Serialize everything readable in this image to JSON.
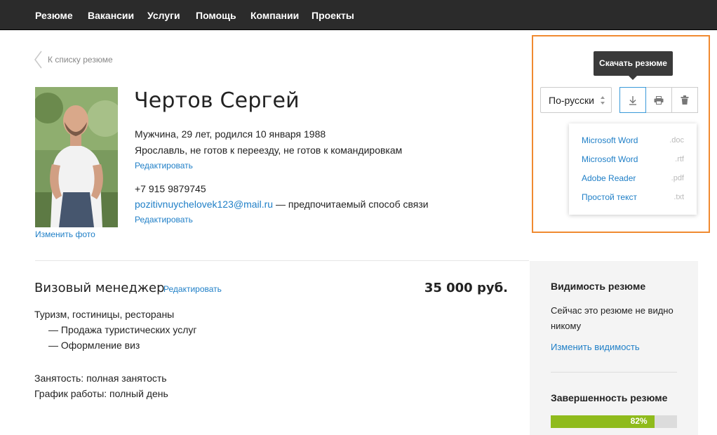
{
  "nav": {
    "items": [
      "Резюме",
      "Вакансии",
      "Услуги",
      "Помощь",
      "Компании",
      "Проекты"
    ]
  },
  "back_link": "К списку резюме",
  "profile": {
    "name": "Чертов Сергей",
    "demographics": "Мужчина, 29 лет, родился 10 января 1988",
    "location": "Ярославль, не готов к переезду, не готов к командировкам",
    "edit_link": "Редактировать",
    "phone": "+7 915 9879745",
    "email": "pozitivnuychelovek123@mail.ru",
    "email_note": " — предпочитаемый способ связи",
    "contacts_edit_link": "Редактировать",
    "change_photo": "Изменить фото"
  },
  "position": {
    "title": "Визовый менеджер",
    "edit_link": "Редактировать",
    "salary": "35 000 руб.",
    "industry": "Туризм, гостиницы, рестораны",
    "specializations": [
      "— Продажа туристических услуг",
      "— Оформление виз"
    ],
    "employment": "Занятость: полная занятость",
    "schedule": "График работы: полный день"
  },
  "toolbar": {
    "tooltip": "Скачать резюме",
    "language": "По-русски",
    "download_icon": "download-icon",
    "print_icon": "print-icon",
    "delete_icon": "trash-icon"
  },
  "download_menu": [
    {
      "label": "Microsoft Word",
      "ext": ".doc"
    },
    {
      "label": "Microsoft Word",
      "ext": ".rtf"
    },
    {
      "label": "Adobe Reader",
      "ext": ".pdf"
    },
    {
      "label": "Простой текст",
      "ext": ".txt"
    }
  ],
  "sidebar": {
    "visibility_title": "Видимость резюме",
    "visibility_text": "Сейчас это резюме не видно никому",
    "visibility_link": "Изменить видимость",
    "completeness_title": "Завершенность резюме",
    "completeness_percent": 82,
    "completeness_label": "82%"
  },
  "colors": {
    "nav_bg": "#2b2b2b",
    "link": "#1f7fc7",
    "highlight_border": "#f08a30",
    "progress_fill": "#8fbb1c",
    "active_button_border": "#3a9ad9"
  }
}
